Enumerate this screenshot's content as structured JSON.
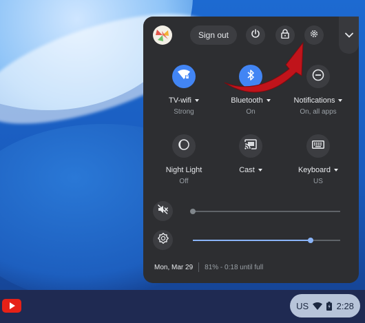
{
  "colors": {
    "panel_bg": "#2d2e31",
    "accent_blue": "#4285f4",
    "shelf_bg": "#1f2a52",
    "annotation_arrow": "#c0141b"
  },
  "header": {
    "sign_out_label": "Sign out",
    "icons": [
      "avatar",
      "power-icon",
      "lock-icon",
      "settings-gear-icon",
      "chevron-down-icon"
    ]
  },
  "tiles": [
    {
      "label": "TV-wifi",
      "sub": "Strong",
      "icon": "wifi-icon",
      "active": true,
      "has_menu": true
    },
    {
      "label": "Bluetooth",
      "sub": "On",
      "icon": "bluetooth-icon",
      "active": true,
      "has_menu": true
    },
    {
      "label": "Notifications",
      "sub": "On, all apps",
      "icon": "do-not-disturb-icon",
      "active": false,
      "has_menu": true
    },
    {
      "label": "Night Light",
      "sub": "Off",
      "icon": "night-light-icon",
      "active": false,
      "has_menu": false
    },
    {
      "label": "Cast",
      "sub": "",
      "icon": "cast-icon",
      "active": false,
      "has_menu": true
    },
    {
      "label": "Keyboard",
      "sub": "US",
      "icon": "keyboard-icon",
      "active": false,
      "has_menu": true
    }
  ],
  "sliders": {
    "volume": {
      "icon": "volume-muted-icon",
      "level": 0.0
    },
    "brightness": {
      "icon": "brightness-icon",
      "level": 0.8
    }
  },
  "footer": {
    "date": "Mon, Mar 29",
    "battery": "81% - 0:18 until full"
  },
  "shelf": {
    "keyboard_layout": "US",
    "time": "2:28",
    "app_icon": "youtube-icon"
  }
}
